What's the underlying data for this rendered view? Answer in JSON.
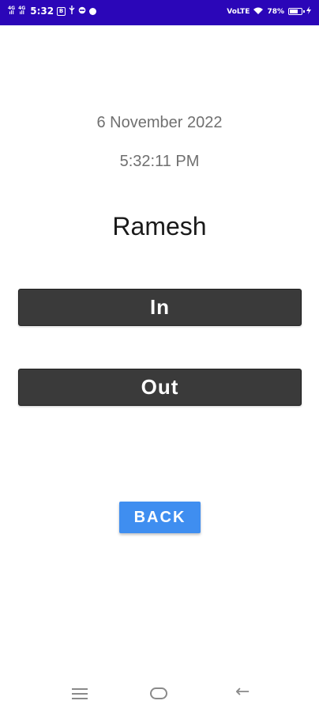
{
  "status_bar": {
    "net1": "4G",
    "net1_sub": "ıll",
    "net2": "4G",
    "net2_sub": "ıll",
    "time": "5:32",
    "icon_b": "B",
    "right_net": "VoLTE",
    "battery_percent": "78%",
    "battery_level": 0.78,
    "icons": [
      "signal-icon",
      "usb-icon",
      "block-icon",
      "chat-icon",
      "wifi-icon",
      "battery-icon",
      "charging-icon"
    ]
  },
  "main": {
    "date": "6 November 2022",
    "time": "5:32:11 PM",
    "name": "Ramesh",
    "in_label": "In",
    "out_label": "Out",
    "back_label": "BACK"
  },
  "nav_bar": {
    "icons": [
      "menu-icon",
      "home-icon",
      "back-arrow-icon"
    ],
    "back_glyph": "←"
  },
  "colors": {
    "status_bar_bg": "#2b06b8",
    "dark_button": "#3a3a3a",
    "back_button": "#3f8ef0",
    "secondary_text": "#707070"
  }
}
